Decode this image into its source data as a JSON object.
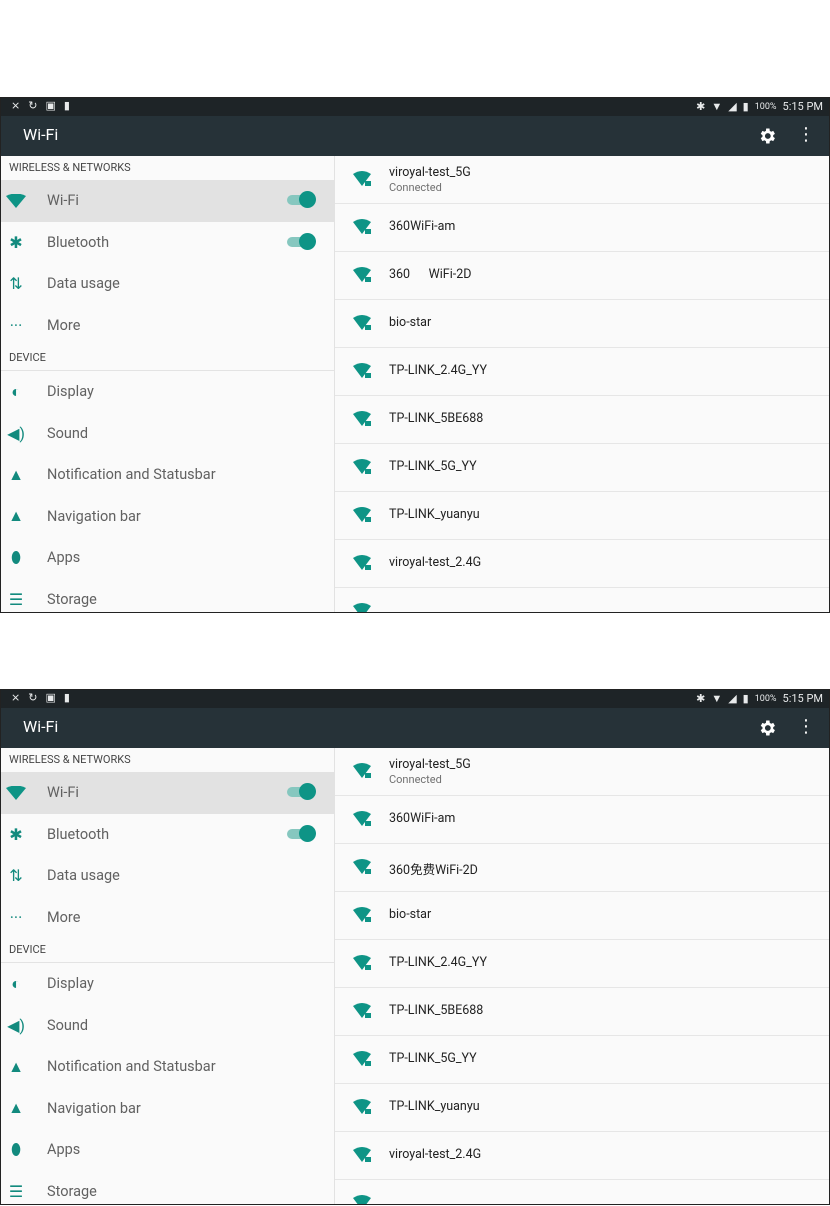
{
  "screens": [
    {
      "status": {
        "battery_pct": "100%",
        "time": "5:15 PM"
      },
      "title": "Wi-Fi",
      "sections": {
        "wireless": "WIRELESS & NETWORKS",
        "device": "DEVICE"
      },
      "wireless_items": [
        {
          "label": "Wi-Fi",
          "icon": "wifi-icon",
          "toggle": true
        },
        {
          "label": "Bluetooth",
          "icon": "bluetooth-icon",
          "toggle": true
        },
        {
          "label": "Data usage",
          "icon": "data-usage-icon"
        },
        {
          "label": "More",
          "icon": "more-icon"
        }
      ],
      "device_items": [
        {
          "label": "Display",
          "icon": "brightness-icon"
        },
        {
          "label": "Sound",
          "icon": "volume-icon"
        },
        {
          "label": "Notification and Statusbar",
          "icon": "bell-icon"
        },
        {
          "label": "Navigation bar",
          "icon": "bell-icon"
        },
        {
          "label": "Apps",
          "icon": "android-icon"
        },
        {
          "label": "Storage",
          "icon": "storage-icon"
        }
      ],
      "networks": [
        {
          "name": "viroyal-test_5G",
          "status": "Connected"
        },
        {
          "name": "360WiFi-am"
        },
        {
          "name": "360      WiFi-2D"
        },
        {
          "name": "bio-star"
        },
        {
          "name": "TP-LINK_2.4G_YY"
        },
        {
          "name": "TP-LINK_5BE688"
        },
        {
          "name": "TP-LINK_5G_YY"
        },
        {
          "name": "TP-LINK_yuanyu"
        },
        {
          "name": "viroyal-test_2.4G"
        }
      ]
    },
    {
      "status": {
        "battery_pct": "100%",
        "time": "5:15 PM"
      },
      "title": "Wi-Fi",
      "sections": {
        "wireless": "WIRELESS & NETWORKS",
        "device": "DEVICE"
      },
      "wireless_items": [
        {
          "label": "Wi-Fi",
          "icon": "wifi-icon",
          "toggle": true
        },
        {
          "label": "Bluetooth",
          "icon": "bluetooth-icon",
          "toggle": true
        },
        {
          "label": "Data usage",
          "icon": "data-usage-icon"
        },
        {
          "label": "More",
          "icon": "more-icon"
        }
      ],
      "device_items": [
        {
          "label": "Display",
          "icon": "brightness-icon"
        },
        {
          "label": "Sound",
          "icon": "volume-icon"
        },
        {
          "label": "Notification and Statusbar",
          "icon": "bell-icon"
        },
        {
          "label": "Navigation bar",
          "icon": "bell-icon"
        },
        {
          "label": "Apps",
          "icon": "android-icon"
        },
        {
          "label": "Storage",
          "icon": "storage-icon"
        }
      ],
      "networks": [
        {
          "name": "viroyal-test_5G",
          "status": "Connected"
        },
        {
          "name": "360WiFi-am"
        },
        {
          "name": "360免费WiFi-2D"
        },
        {
          "name": "bio-star"
        },
        {
          "name": "TP-LINK_2.4G_YY"
        },
        {
          "name": "TP-LINK_5BE688"
        },
        {
          "name": "TP-LINK_5G_YY"
        },
        {
          "name": "TP-LINK_yuanyu"
        },
        {
          "name": "viroyal-test_2.4G"
        }
      ]
    }
  ],
  "colors": {
    "accent": "#0e9486",
    "appbar": "#263238",
    "statusbar": "#1e2427"
  }
}
